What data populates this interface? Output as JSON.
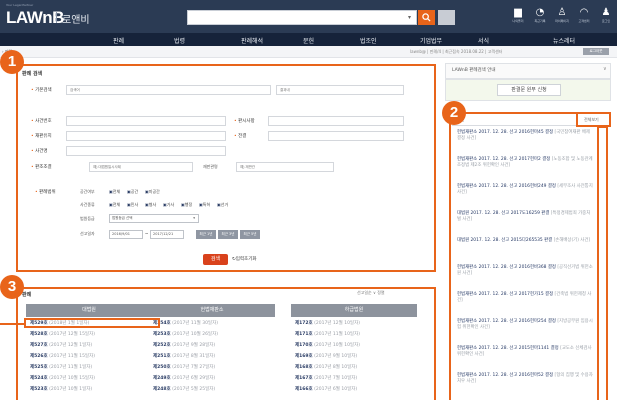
{
  "header": {
    "logo_sub": "Your Legal Partner",
    "logo": "LAWnB",
    "logo_kr": "로앤비",
    "search_placeholder": "",
    "icons": [
      {
        "name": "folder-icon",
        "glyph": "▆",
        "label": "나의폴더"
      },
      {
        "name": "history-icon",
        "glyph": "◔",
        "label": "최근기록"
      },
      {
        "name": "mypage-icon",
        "glyph": "♙",
        "label": "마이페이지"
      },
      {
        "name": "support-icon",
        "glyph": "◠",
        "label": "고객센터"
      },
      {
        "name": "user-icon",
        "glyph": "♟",
        "label": "로그인"
      }
    ]
  },
  "nav": [
    "판례",
    "법령",
    "판례해석",
    "문헌",
    "법조인",
    "기업법무",
    "서식",
    "뉴스레터"
  ],
  "breadcrumb": {
    "left": "› 판례",
    "right": "lawnb@ | 판례/4 | 최근접속 2018.08.22 | 고객센터",
    "badge": "로그아웃"
  },
  "search_panel": {
    "title": "판례 검색",
    "basic_label": "기본검색",
    "basic_placeholder": "검색어",
    "basic2_placeholder": "결과내",
    "fields_left": [
      "사건번호",
      "재판유지",
      "사건명"
    ],
    "fields_right": [
      "판시사항",
      "전결"
    ],
    "court_label": "판조조결",
    "court_placeholder": "예) 대법원일시사례",
    "judge_label": "재판관명",
    "judge_placeholder": "예) 재판관",
    "filter_label": "판례범위",
    "rows": [
      {
        "label": "공간여부",
        "opts": [
          "전체",
          "공간",
          "미공간"
        ]
      },
      {
        "label": "사건종류",
        "opts": [
          "전체",
          "민사",
          "형사",
          "가사",
          "행정",
          "특허",
          "선거"
        ]
      }
    ],
    "court_select_label": "법원등급",
    "court_select_value": "법원등급 선택",
    "date_label": "선고일자",
    "date_from": "2016/9/01",
    "date_to": "2017/12/21",
    "date_buttons": [
      "최근 1년",
      "최근 3년",
      "최근 5년"
    ],
    "search_button": "검색",
    "reset_button": "입력초기화"
  },
  "results_panel": {
    "title": "판례",
    "sort": "선고일순 ∨ 정렬",
    "columns": [
      {
        "header": "대법원",
        "items": [
          [
            "제529호",
            "(2018년 1월 1일자)"
          ],
          [
            "제528호",
            "(2017년 12월 15일자)"
          ],
          [
            "제527호",
            "(2017년 12월 1일자)"
          ],
          [
            "제526호",
            "(2017년 11월 15일자)"
          ],
          [
            "제525호",
            "(2017년 11월 1일자)"
          ],
          [
            "제524호",
            "(2017년 10월 15일자)"
          ],
          [
            "제523호",
            "(2017년 10월 1일자)"
          ]
        ]
      },
      {
        "header": "헌법재판소",
        "items": [
          [
            "제254호",
            "(2017년 11월 30일자)"
          ],
          [
            "제253호",
            "(2017년 10월 26일자)"
          ],
          [
            "제252호",
            "(2017년 9월 28일자)"
          ],
          [
            "제251호",
            "(2017년 8월 31일자)"
          ],
          [
            "제250호",
            "(2017년 7월 27일자)"
          ],
          [
            "제249호",
            "(2017년 6월 29일자)"
          ],
          [
            "제248호",
            "(2017년 5월 25일자)"
          ]
        ]
      },
      {
        "header": "하급법원",
        "items": [
          [
            "제172호",
            "(2017년 12월 10일자)"
          ],
          [
            "제171호",
            "(2017년 11월 10일자)"
          ],
          [
            "제170호",
            "(2017년 10월 10일자)"
          ],
          [
            "제169호",
            "(2017년 9월 10일자)"
          ],
          [
            "제168호",
            "(2017년 8월 10일자)"
          ],
          [
            "제167호",
            "(2017년 7월 10일자)"
          ],
          [
            "제166호",
            "(2017년 6월 10일자)"
          ]
        ]
      }
    ]
  },
  "sidebar": {
    "head": "LAWnB 판례검색 안내",
    "link_button": "판결문 원부 신청",
    "tab1": "최신",
    "tab2": "전체보기",
    "news": [
      {
        "hd": "헌법재판소 2017. 12. 28. 선고 2016헌마45 결정",
        "tl": "[국민참여재판 배제 결정 사건]"
      },
      {
        "hd": "헌법재판소 2017. 12. 28. 선고 2017헌마2 결정",
        "tl": "[노동조합 및 노동관계조정법 제2조 위헌확인 사건]"
      },
      {
        "hd": "헌법재판소 2017. 12. 28. 선고 2016헌바249 결정",
        "tl": "[세무조사 사전통지 사건]"
      },
      {
        "hd": "대법원 2017. 12. 28. 선고 2017도16259 판결",
        "tl": "[특정경제범죄 가중처벌 사건]"
      },
      {
        "hd": "대법원 2017. 12. 28. 선고 2015다265535 판결",
        "tl": "[손해배상(기) 사건]"
      },
      {
        "hd": "헌법재판소 2017. 12. 28. 선고 2016헌바368 결정",
        "tl": "[공직선거법 위헌소원 사건]"
      },
      {
        "hd": "헌법재판소 2017. 12. 28. 선고 2017헌가15 결정",
        "tl": "[건축법 위헌제청 사건]"
      },
      {
        "hd": "헌법재판소 2017. 12. 28. 선고 2016헌마254 결정",
        "tl": "[지방공무원 임용시험 위헌확인 사건]"
      },
      {
        "hd": "헌법재판소 2017. 12. 28. 선고 2015헌마1141 결정",
        "tl": "[교도소 신체검사 위헌확인 사건]"
      },
      {
        "hd": "헌법재판소 2017. 12. 28. 선고 2016헌마52 결정",
        "tl": "[형의 집행 및 수용자 처우 사건]"
      }
    ]
  },
  "badges": [
    "1",
    "2",
    "3"
  ]
}
